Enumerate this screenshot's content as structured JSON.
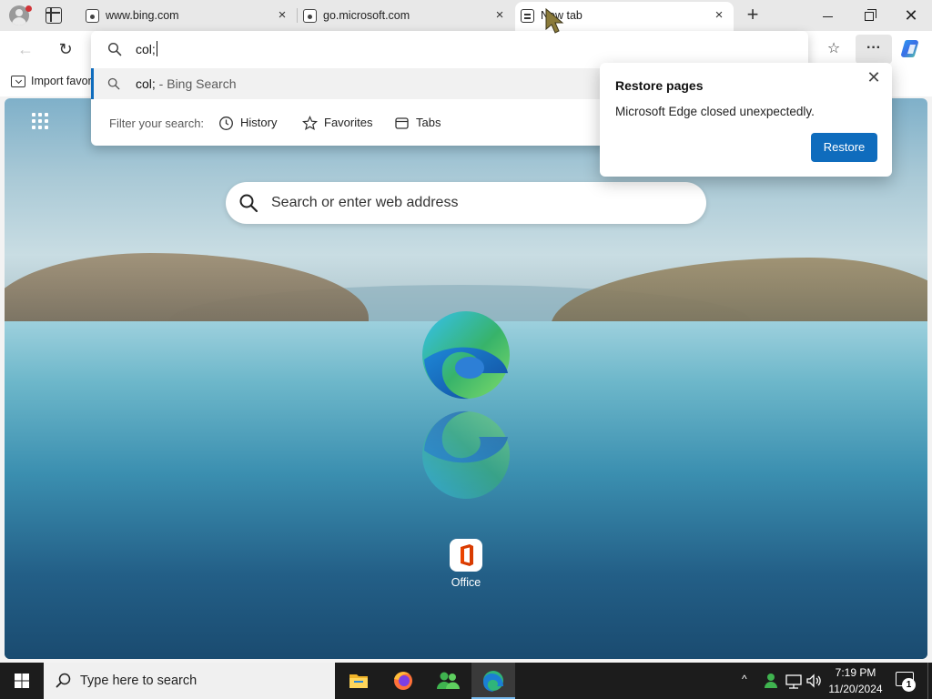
{
  "tabs": [
    {
      "title": "www.bing.com",
      "active": false
    },
    {
      "title": "go.microsoft.com",
      "active": false
    },
    {
      "title": "New tab",
      "active": true
    }
  ],
  "tab_close_glyph": "×",
  "new_tab_glyph": "+",
  "window_controls": {
    "close_glyph": "✕"
  },
  "toolbar": {
    "back_glyph": "←",
    "refresh_glyph": "↻",
    "favorites_glyph": "☆",
    "more_glyph": "···"
  },
  "favorites_bar": {
    "import_label": "Import favor"
  },
  "omnibox": {
    "value": "col;",
    "suggestion": {
      "query": "col;",
      "suffix": " - Bing Search"
    },
    "filter_label": "Filter your search:",
    "filters": [
      {
        "label": "History",
        "icon": "history-icon"
      },
      {
        "label": "Favorites",
        "icon": "star-icon"
      },
      {
        "label": "Tabs",
        "icon": "tabs-icon"
      }
    ]
  },
  "restore_popup": {
    "title": "Restore pages",
    "message": "Microsoft Edge closed unexpectedly.",
    "button": "Restore",
    "close_glyph": "✕"
  },
  "ntp": {
    "search_placeholder": "Search or enter web address",
    "quick_link": {
      "label": "Office"
    }
  },
  "taskbar": {
    "search_placeholder": "Type here to search",
    "apps": [
      "file-explorer-icon",
      "firefox-icon",
      "people-icon",
      "edge-icon"
    ],
    "clock_time": "7:19 PM",
    "clock_date": "11/20/2024",
    "notification_count": "1",
    "tray_up_glyph": "^"
  },
  "colors": {
    "accent": "#0f6cbd",
    "taskbar": "#1c1c1c",
    "titlebar": "#e8e8e8"
  }
}
